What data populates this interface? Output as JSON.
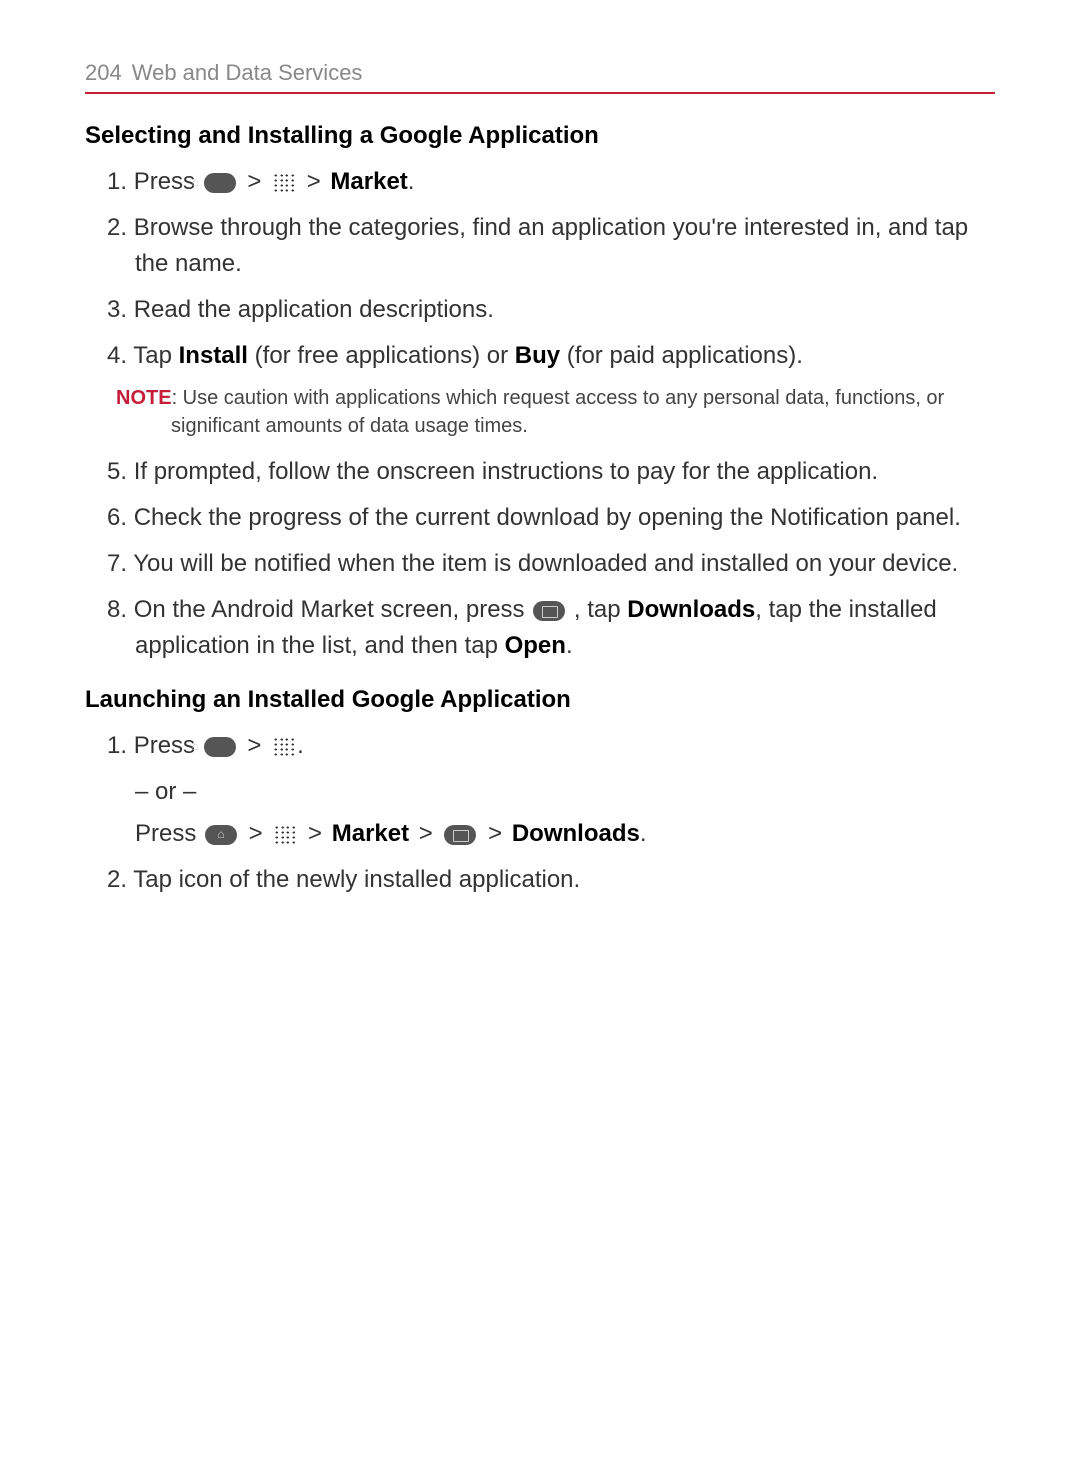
{
  "header": {
    "page_number": "204",
    "chapter_title": "Web and Data Services"
  },
  "section1": {
    "heading": "Selecting and Installing a Google Application",
    "steps": {
      "s1": {
        "num": "1.",
        "prefix": "Press ",
        "sep1": " > ",
        "sep2": " > ",
        "bold": "Market",
        "suffix": "."
      },
      "s2": {
        "num": "2.",
        "text": "Browse through the categories, find an application you're interested in, and tap the name."
      },
      "s3": {
        "num": "3.",
        "text": "Read the application descriptions."
      },
      "s4": {
        "num": "4.",
        "prefix": "Tap ",
        "bold1": "Install",
        "mid": " (for free applications) or ",
        "bold2": "Buy",
        "suffix": " (for paid applications)."
      },
      "note": {
        "label": "NOTE",
        "text": ": Use caution with applications which request access to any personal data, functions, or significant amounts of data usage times."
      },
      "s5": {
        "num": "5.",
        "text": "If prompted, follow the onscreen instructions to pay for the application."
      },
      "s6": {
        "num": "6.",
        "text": "Check the progress of the current download by opening the Notification panel."
      },
      "s7": {
        "num": "7.",
        "text": "You will be notified when the item is downloaded and installed on your device."
      },
      "s8": {
        "num": "8.",
        "prefix": "On the Android Market screen, press ",
        "mid1": " , tap ",
        "bold1": "Downloads",
        "mid2": ", tap the installed application in the list, and then tap ",
        "bold2": "Open",
        "suffix": "."
      }
    }
  },
  "section2": {
    "heading": "Launching an Installed Google Application",
    "steps": {
      "s1": {
        "num": "1.",
        "prefix": "Press ",
        "sep1": " > ",
        "suffix": ".",
        "or": "– or –",
        "alt_prefix": "Press ",
        "alt_sep1": " > ",
        "alt_sep2": " > ",
        "alt_bold1": "Market",
        "alt_sep3": " > ",
        "alt_sep4": " > ",
        "alt_bold2": "Downloads",
        "alt_suffix": "."
      },
      "s2": {
        "num": "2.",
        "text": "Tap icon of the newly installed application."
      }
    }
  }
}
